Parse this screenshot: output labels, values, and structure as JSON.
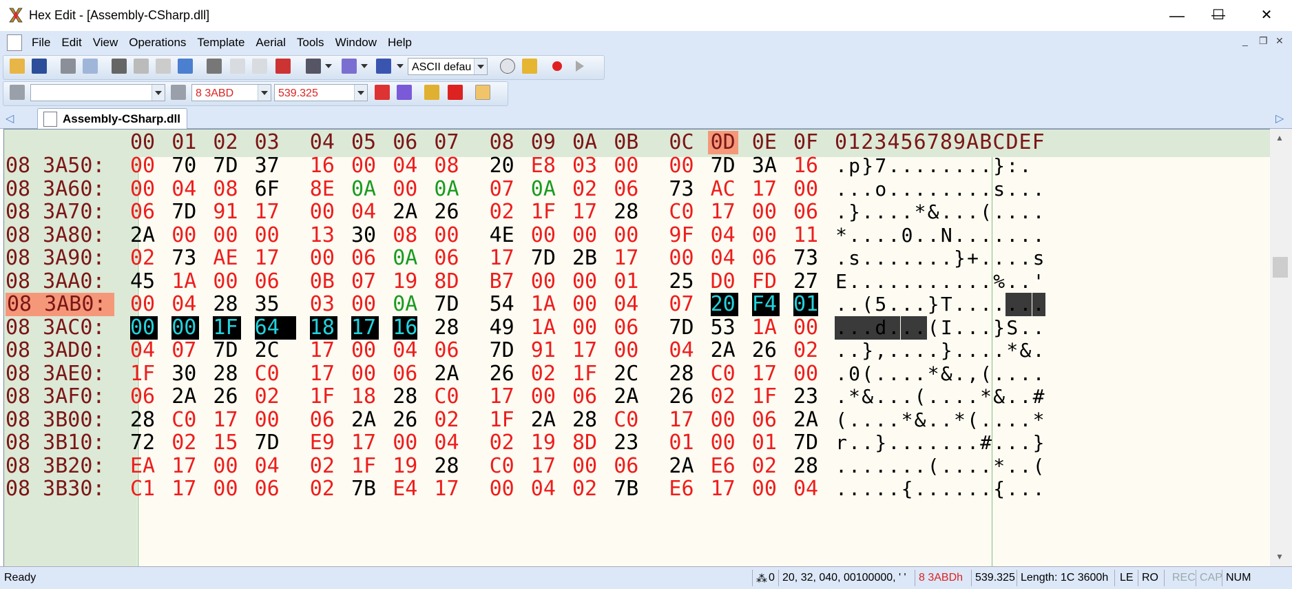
{
  "window": {
    "title": "Hex Edit - [Assembly-CSharp.dll]",
    "minimize": "—",
    "maximize": "☐",
    "close": "✕"
  },
  "menu": [
    "File",
    "Edit",
    "View",
    "Operations",
    "Template",
    "Aerial",
    "Tools",
    "Window",
    "Help"
  ],
  "toolbar": {
    "charset": "ASCII defau",
    "address": "8 3ABD",
    "decimal": "539.325",
    "search": ""
  },
  "tab": {
    "label": "Assembly-CSharp.dll"
  },
  "editor": {
    "col_headers": [
      "00",
      "01",
      "02",
      "03",
      "04",
      "05",
      "06",
      "07",
      "08",
      "09",
      "0A",
      "0B",
      "0C",
      "0D",
      "0E",
      "0F"
    ],
    "char_header": "0123456789ABCDEF",
    "rows": [
      {
        "addr": "08 3A50:",
        "hex": [
          "00",
          "70",
          "7D",
          "37",
          "16",
          "00",
          "04",
          "08",
          "20",
          "E8",
          "03",
          "00",
          "00",
          "7D",
          "3A",
          "16"
        ],
        "chars": ".p}7........}:."
      },
      {
        "addr": "08 3A60:",
        "hex": [
          "00",
          "04",
          "08",
          "6F",
          "8E",
          "0A",
          "00",
          "0A",
          "07",
          "0A",
          "02",
          "06",
          "73",
          "AC",
          "17",
          "00"
        ],
        "chars": "...o........s..."
      },
      {
        "addr": "08 3A70:",
        "hex": [
          "06",
          "7D",
          "91",
          "17",
          "00",
          "04",
          "2A",
          "26",
          "02",
          "1F",
          "17",
          "28",
          "C0",
          "17",
          "00",
          "06"
        ],
        "chars": ".}....*&...(...."
      },
      {
        "addr": "08 3A80:",
        "hex": [
          "2A",
          "00",
          "00",
          "00",
          "13",
          "30",
          "08",
          "00",
          "4E",
          "00",
          "00",
          "00",
          "9F",
          "04",
          "00",
          "11"
        ],
        "chars": "*....0..N......."
      },
      {
        "addr": "08 3A90:",
        "hex": [
          "02",
          "73",
          "AE",
          "17",
          "00",
          "06",
          "0A",
          "06",
          "17",
          "7D",
          "2B",
          "17",
          "00",
          "04",
          "06",
          "73"
        ],
        "chars": ".s.......}+....s"
      },
      {
        "addr": "08 3AA0:",
        "hex": [
          "45",
          "1A",
          "00",
          "06",
          "0B",
          "07",
          "19",
          "8D",
          "B7",
          "00",
          "00",
          "01",
          "25",
          "D0",
          "FD",
          "27"
        ],
        "chars": "E...........%..'"
      },
      {
        "addr": "08 3AB0:",
        "hex": [
          "00",
          "04",
          "28",
          "35",
          "03",
          "00",
          "0A",
          "7D",
          "54",
          "1A",
          "00",
          "04",
          "07",
          "20",
          "F4",
          "01"
        ],
        "chars": "..(5...}T......."
      },
      {
        "addr": "08 3AC0:",
        "hex": [
          "00",
          "00",
          "1F",
          "64",
          "18",
          "17",
          "16",
          "28",
          "49",
          "1A",
          "00",
          "06",
          "7D",
          "53",
          "1A",
          "00"
        ],
        "chars": "...d...(I...}S.."
      },
      {
        "addr": "08 3AD0:",
        "hex": [
          "04",
          "07",
          "7D",
          "2C",
          "17",
          "00",
          "04",
          "06",
          "7D",
          "91",
          "17",
          "00",
          "04",
          "2A",
          "26",
          "02"
        ],
        "chars": "..},....}....*&."
      },
      {
        "addr": "08 3AE0:",
        "hex": [
          "1F",
          "30",
          "28",
          "C0",
          "17",
          "00",
          "06",
          "2A",
          "26",
          "02",
          "1F",
          "2C",
          "28",
          "C0",
          "17",
          "00"
        ],
        "chars": ".0(....*&.,(...."
      },
      {
        "addr": "08 3AF0:",
        "hex": [
          "06",
          "2A",
          "26",
          "02",
          "1F",
          "18",
          "28",
          "C0",
          "17",
          "00",
          "06",
          "2A",
          "26",
          "02",
          "1F",
          "23"
        ],
        "chars": ".*&...(....*&..#"
      },
      {
        "addr": "08 3B00:",
        "hex": [
          "28",
          "C0",
          "17",
          "00",
          "06",
          "2A",
          "26",
          "02",
          "1F",
          "2A",
          "28",
          "C0",
          "17",
          "00",
          "06",
          "2A"
        ],
        "chars": "(....*&..*(....*"
      },
      {
        "addr": "08 3B10:",
        "hex": [
          "72",
          "02",
          "15",
          "7D",
          "E9",
          "17",
          "00",
          "04",
          "02",
          "19",
          "8D",
          "23",
          "01",
          "00",
          "01",
          "7D"
        ],
        "chars": "r..}.......#...}"
      },
      {
        "addr": "08 3B20:",
        "hex": [
          "EA",
          "17",
          "00",
          "04",
          "02",
          "1F",
          "19",
          "28",
          "C0",
          "17",
          "00",
          "06",
          "2A",
          "E6",
          "02",
          "28"
        ],
        "chars": ".......(....*..("
      },
      {
        "addr": "08 3B30:",
        "hex": [
          "C1",
          "17",
          "00",
          "06",
          "02",
          "7B",
          "E4",
          "17",
          "00",
          "04",
          "02",
          "7B",
          "E6",
          "17",
          "00",
          "04"
        ],
        "chars": ".....{......{..."
      }
    ]
  },
  "status": {
    "ready": "Ready",
    "count": "0",
    "value": "20, 32, 040, 00100000, ' '",
    "address": "8 3ABDh",
    "decimal": "539.325",
    "length": "Length: 1C 3600h",
    "endian": "LE",
    "mode": "RO",
    "rec": "REC",
    "cap": "CAP",
    "num": "NUM"
  },
  "colors": {
    "black": "#000000",
    "red": "#ee1d1d",
    "green": "#1a9a22",
    "address": "#7b1616",
    "highlight": "#f5987a",
    "selection_text": "#22d3dd",
    "gutter": "#dce9d6",
    "data_bg": "#fefcf2"
  }
}
